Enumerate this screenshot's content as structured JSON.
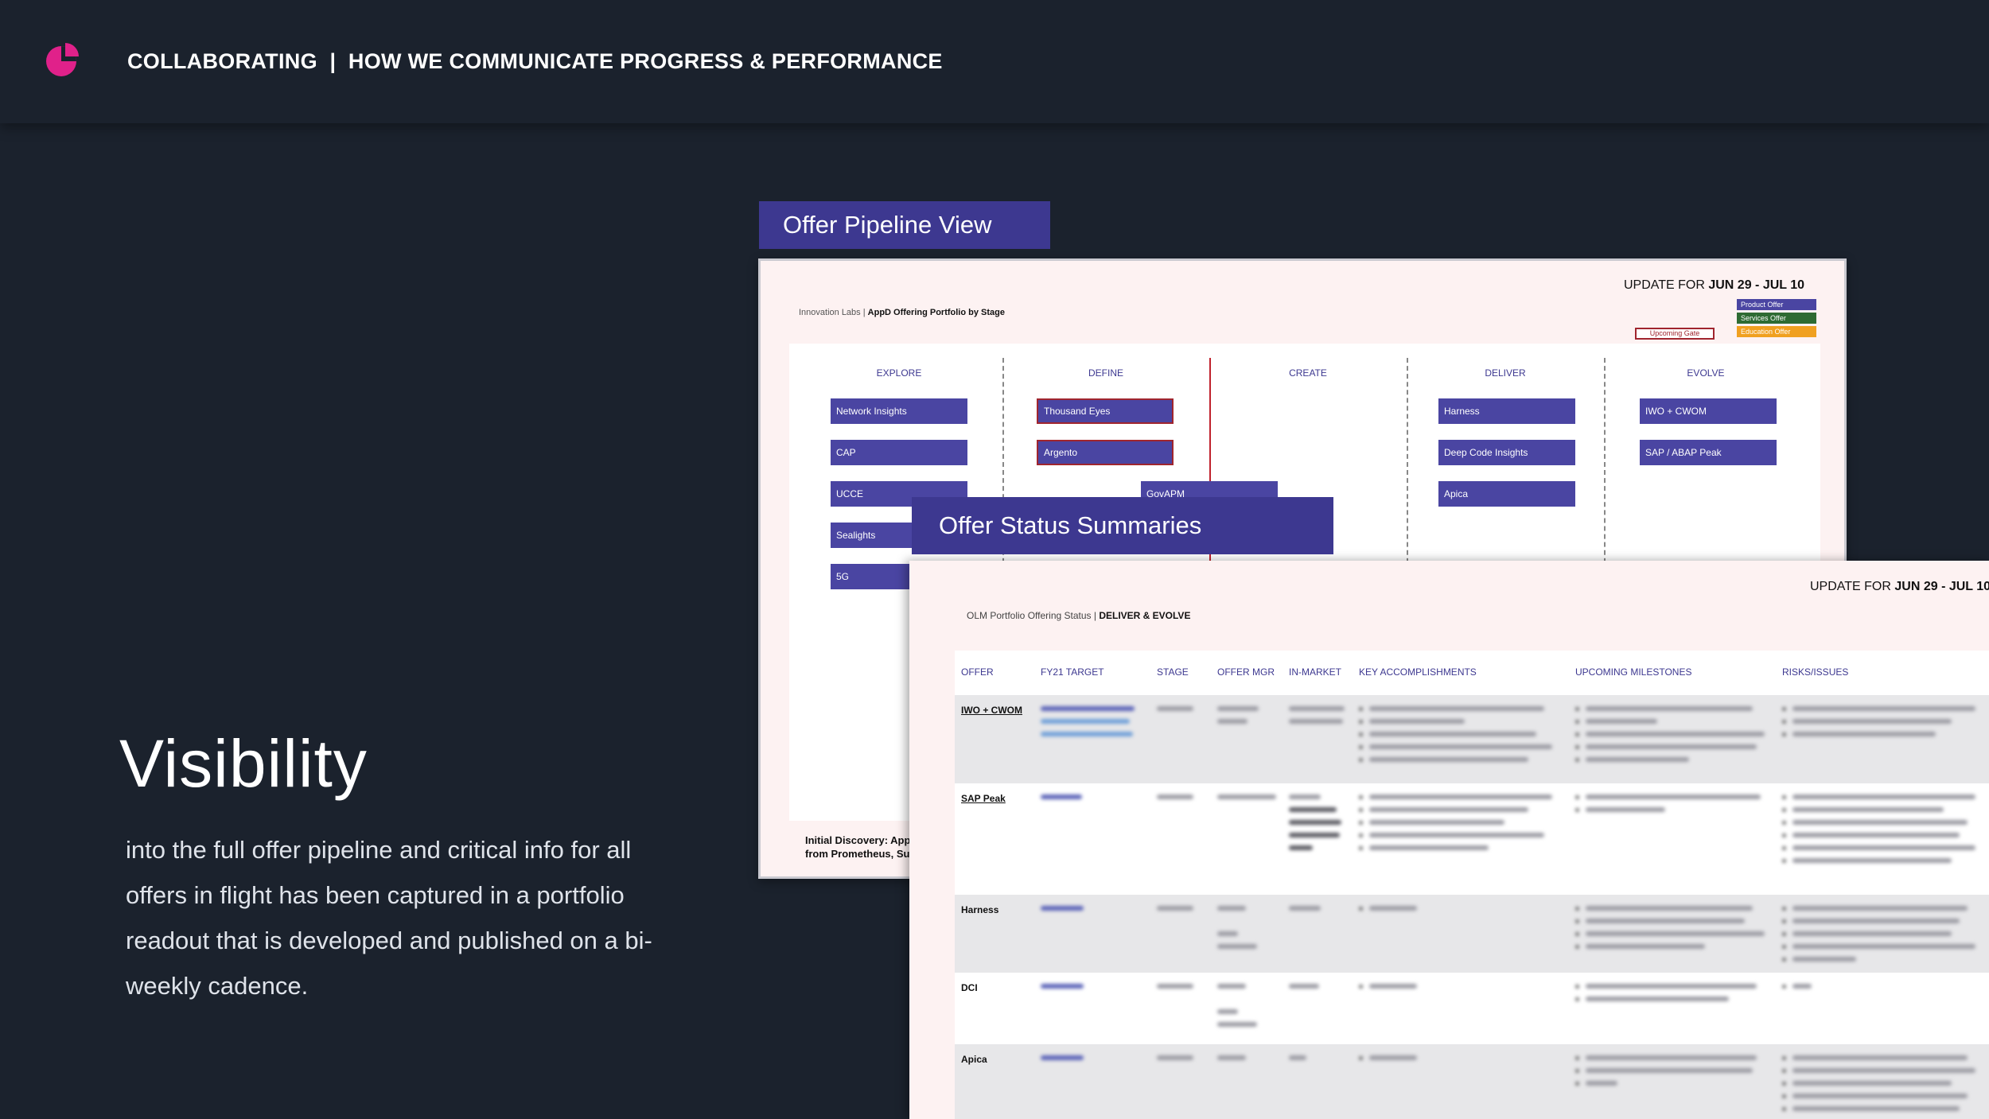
{
  "header": {
    "title": "COLLABORATING  |  HOW WE COMMUNICATE PROGRESS & PERFORMANCE",
    "logo_icon": "pie-chart-icon",
    "logo_color": "#e0218a"
  },
  "main": {
    "headline": "Visibility",
    "body": "into the full offer pipeline and critical info for all offers in flight has been captured in a portfolio readout that is developed and published on a bi-weekly cadence."
  },
  "pipeline": {
    "tab_label": "Offer Pipeline View",
    "update_prefix": "UPDATE FOR ",
    "update_dates": "JUN 29 - JUL 10",
    "subtitle_org": "Innovation Labs | ",
    "subtitle_title": "AppD Offering Portfolio by Stage",
    "legend": [
      {
        "label": "Product Offer",
        "color": "#4a45a2"
      },
      {
        "label": "Services Offer",
        "color": "#2e6b33"
      },
      {
        "label": "Education Offer",
        "color": "#f0a020"
      }
    ],
    "gate_label": "Upcoming Gate",
    "stages": [
      "EXPLORE",
      "DEFINE",
      "CREATE",
      "DELIVER",
      "EVOLVE"
    ],
    "offers": {
      "explore": [
        "Network Insights",
        "CAP",
        "UCCE",
        "Sealights",
        "5G"
      ],
      "define": [
        "Thousand Eyes",
        "Argento",
        "GovAPM"
      ],
      "deliver": [
        "Harness",
        "Deep Code Insights",
        "Apica"
      ],
      "evolve": [
        "IWO + CWOM",
        "SAP / ABAP Peak"
      ]
    },
    "footer_line1": "Initial Discovery: App",
    "footer_line2": "from Prometheus, Su"
  },
  "status": {
    "tab_label": "Offer Status Summaries",
    "update_prefix": "UPDATE FOR ",
    "update_dates": "JUN 29 - JUL 10",
    "subtitle_org": "OLM Portfolio Offering Status | ",
    "subtitle_title": "DELIVER & EVOLVE",
    "columns": [
      "OFFER",
      "FY21 TARGET",
      "STAGE",
      "OFFER MGR",
      "IN-MARKET",
      "KEY ACCOMPLISHMENTS",
      "UPCOMING MILESTONES",
      "RISKS/ISSUES"
    ],
    "rows": [
      {
        "offer": "IWO + CWOM"
      },
      {
        "offer": "SAP Peak"
      },
      {
        "offer": "Harness"
      },
      {
        "offer": "DCI"
      },
      {
        "offer": "Apica"
      }
    ]
  }
}
